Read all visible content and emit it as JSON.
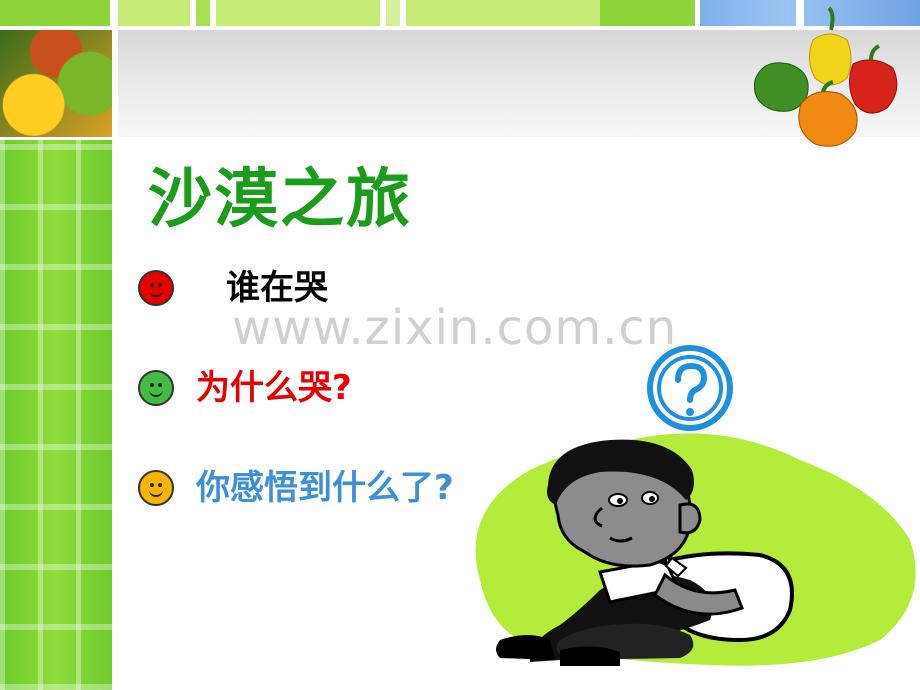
{
  "slide": {
    "title": "沙漠之旅",
    "watermark": "www.zixin.com.cn",
    "bullets": [
      {
        "text": "谁在哭",
        "text_color": "#000000",
        "icon": "smiley-red-icon",
        "icon_color": "#e60000"
      },
      {
        "text": "为什么哭?",
        "text_color": "#e60000",
        "icon": "smiley-green-icon",
        "icon_color": "#44bb44"
      },
      {
        "text": "你感悟到什么了?",
        "text_color": "#3f8fd8",
        "icon": "smiley-yellow-icon",
        "icon_color": "#f5b400"
      }
    ],
    "colors": {
      "title": "#1c9c1c",
      "accent_green": "#8fd53a",
      "accent_blue": "#7fb0ea",
      "question_badge": "#1e90e0",
      "blob": "#b4ec3c"
    }
  }
}
